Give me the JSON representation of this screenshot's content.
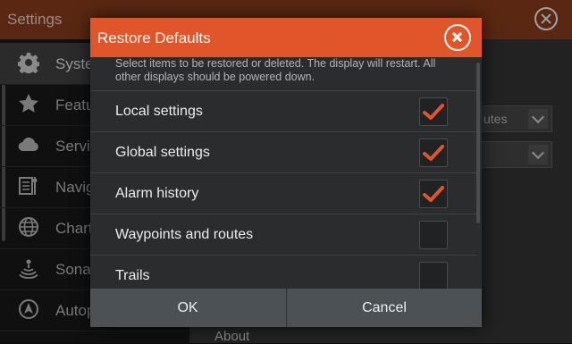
{
  "background": {
    "title": "Settings",
    "sidebar": [
      {
        "label": "System",
        "icon": "gear-icon"
      },
      {
        "label": "Features",
        "icon": "star-icon"
      },
      {
        "label": "Services",
        "icon": "cloud-icon"
      },
      {
        "label": "Navigation",
        "icon": "navigation-icon"
      },
      {
        "label": "Chart",
        "icon": "globe-icon"
      },
      {
        "label": "Sonar",
        "icon": "sonar-icon"
      },
      {
        "label": "Autopilot",
        "icon": "autopilot-icon"
      }
    ],
    "dropdown_partial_text": "utes",
    "about_label": "About"
  },
  "dialog": {
    "title": "Restore Defaults",
    "description": "Select items to be restored or deleted. The display will restart. All other displays should be powered down.",
    "options": [
      {
        "label": "Local settings",
        "checked": true
      },
      {
        "label": "Global settings",
        "checked": true
      },
      {
        "label": "Alarm history",
        "checked": true
      },
      {
        "label": "Waypoints and routes",
        "checked": false
      },
      {
        "label": "Trails",
        "checked": false
      }
    ],
    "ok_label": "OK",
    "cancel_label": "Cancel"
  },
  "colors": {
    "accent": "#e0552a",
    "check": "#e0552a",
    "footer": "#4c5155",
    "dialog_bg": "#2a2c2e"
  }
}
